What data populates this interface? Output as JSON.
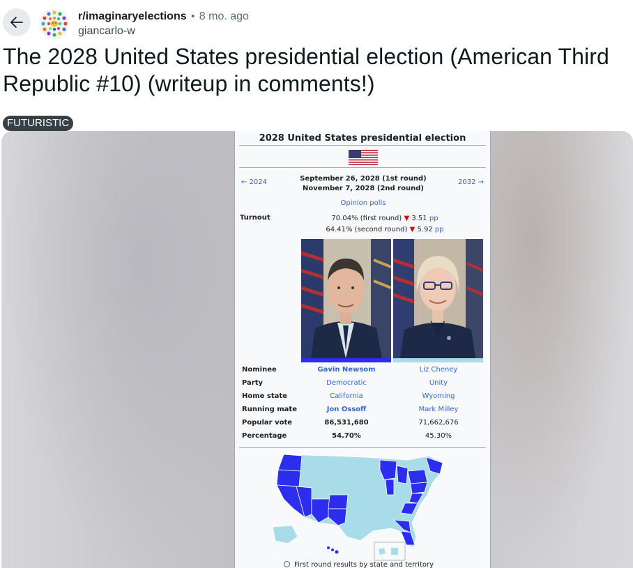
{
  "header": {
    "subreddit": "r/imaginaryelections",
    "separator": "•",
    "age": "8 mo. ago",
    "username": "giancarlo-w"
  },
  "post": {
    "title": "The 2028 United States presidential election (American Third Republic #10) (writeup in comments!)",
    "flair": "FUTURISTIC"
  },
  "infobox": {
    "title": "2028 United States presidential election",
    "prev_link": "← 2024",
    "next_link": "2032 →",
    "date_line_1": "September 26, 2028 (1st round)",
    "date_line_2": "November 7, 2028 (2nd round)",
    "polls_link": "Opinion polls",
    "turnout_label": "Turnout",
    "turnout_1_text": "70.04% (first round)",
    "turnout_1_change": "3.51",
    "turnout_2_text": "64.41% (second round)",
    "turnout_2_change": "5.92",
    "pp_label": "pp",
    "down_arrow": "▼",
    "rows": {
      "nominee": {
        "label": "Nominee",
        "c1": "Gavin Newsom",
        "c2": "Liz Cheney"
      },
      "party": {
        "label": "Party",
        "c1": "Democratic",
        "c2": "Unity"
      },
      "home_state": {
        "label": "Home state",
        "c1": "California",
        "c2": "Wyoming"
      },
      "running_mate": {
        "label": "Running mate",
        "c1": "Jon Ossoff",
        "c2": "Mark Milley"
      },
      "popular_vote": {
        "label": "Popular vote",
        "c1": "86,531,680",
        "c2": "71,662,676"
      },
      "percentage": {
        "label": "Percentage",
        "c1": "54.70%",
        "c2": "45.30%"
      }
    },
    "colors": {
      "candidate_1": "#2d2df0",
      "candidate_2": "#a8dce8"
    },
    "map_caption": "First round results by state and territory"
  },
  "icons": {
    "back": "arrow-left-icon",
    "avatar": "subreddit-avatar-icon"
  }
}
